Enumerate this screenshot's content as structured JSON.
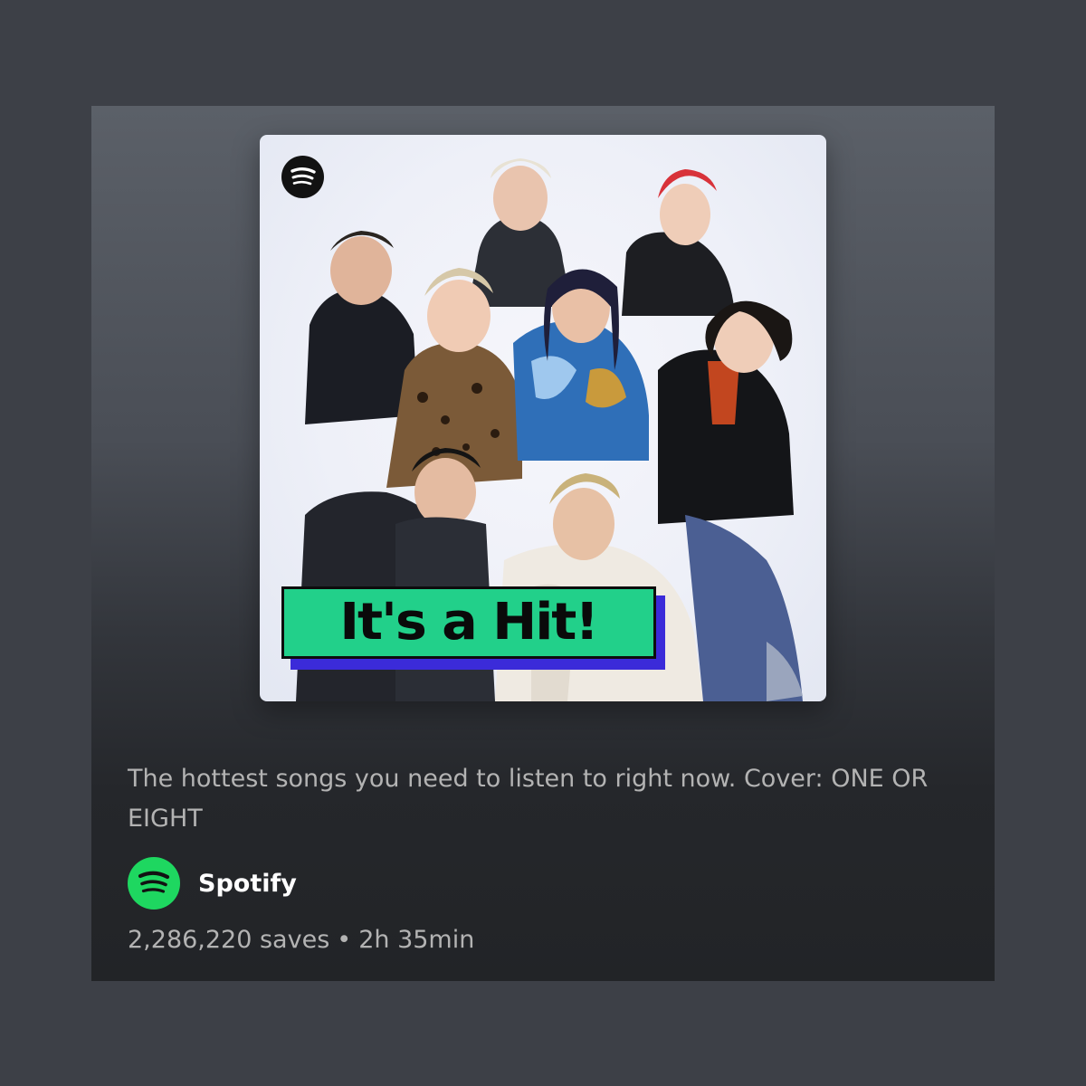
{
  "playlist": {
    "cover": {
      "alt": "Playlist cover featuring ONE OR EIGHT",
      "badge_text": "It's a Hit!",
      "logo_icon": "spotify-logo-icon"
    },
    "description": "The hottest songs you need to listen to right now. Cover: ONE OR EIGHT",
    "owner": {
      "name": "Spotify",
      "avatar_icon": "spotify-logo-icon"
    },
    "meta": {
      "saves": "2,286,220 saves",
      "separator": "•",
      "duration": "2h 35min"
    }
  },
  "colors": {
    "page_background": "#3d4047",
    "spotify_green": "#1ed760",
    "badge_green": "#22d08a",
    "badge_shadow": "#3b2bd9",
    "text_secondary": "#b3b3b3",
    "text_primary": "#ffffff"
  }
}
